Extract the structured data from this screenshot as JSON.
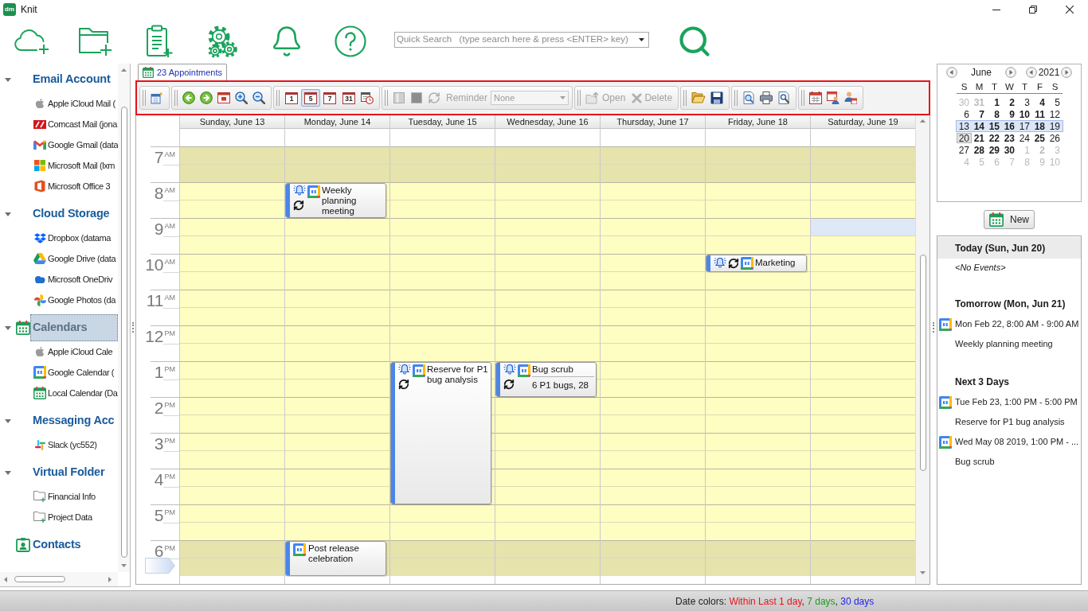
{
  "window": {
    "logo": "dm",
    "title": "Knit"
  },
  "quick_search": {
    "placeholder": "Quick Search   (type search here & press <ENTER> key)"
  },
  "sidebar": {
    "sections": [
      {
        "title": "Email Account",
        "expanded": true,
        "selected": false,
        "items": [
          {
            "label": "Apple iCloud Mail ("
          },
          {
            "label": "Comcast Mail (jona"
          },
          {
            "label": "Google Gmail (data"
          },
          {
            "label": "Microsoft Mail (lxm"
          },
          {
            "label": "Microsoft Office 3"
          }
        ]
      },
      {
        "title": "Cloud Storage",
        "expanded": true,
        "selected": false,
        "items": [
          {
            "label": "Dropbox (datama"
          },
          {
            "label": "Google Drive (data"
          },
          {
            "label": "Microsoft OneDriv"
          },
          {
            "label": "Google Photos (da"
          }
        ]
      },
      {
        "title": "Calendars",
        "expanded": true,
        "selected": true,
        "items": [
          {
            "label": "Apple iCloud Cale"
          },
          {
            "label": "Google Calendar ("
          },
          {
            "label": "Local Calendar (Da"
          }
        ]
      },
      {
        "title": "Messaging Acc",
        "expanded": true,
        "selected": false,
        "items": [
          {
            "label": "Slack (yc552)"
          }
        ]
      },
      {
        "title": "Virtual Folder",
        "expanded": true,
        "selected": false,
        "items": [
          {
            "label": "Financial Info"
          },
          {
            "label": "Project Data"
          }
        ]
      },
      {
        "title": "Contacts",
        "selected": false
      }
    ]
  },
  "tabs": [
    {
      "label": "23 Appointments",
      "selected": true
    }
  ],
  "toolbar": {
    "views": [
      {
        "label": "1",
        "selected": false
      },
      {
        "label": "5",
        "selected": true
      },
      {
        "label": "7",
        "selected": false
      },
      {
        "label": "31",
        "selected": false
      }
    ],
    "reminder": {
      "label": "Reminder",
      "value": "None",
      "disabled": true
    },
    "open": {
      "label": "Open",
      "disabled": true
    },
    "delete": {
      "label": "Delete",
      "disabled": true
    }
  },
  "calendar": {
    "columns": [
      {
        "header": "Sunday, June 13",
        "selected": false
      },
      {
        "header": "Monday, June 14",
        "selected": false,
        "events": [
          {
            "title": "Weekly planning meeting",
            "reminder": true,
            "recurring": true
          },
          {
            "title": "Post release celebration",
            "reminder": false,
            "recurring": false
          }
        ]
      },
      {
        "header": "Tuesday, June 15",
        "selected": false,
        "events": [
          {
            "title": "Reserve for P1 bug analysis",
            "reminder": true,
            "recurring": true
          }
        ]
      },
      {
        "header": "Wednesday, June 16",
        "selected": false,
        "events": [
          {
            "title": "Bug scrub",
            "detail": "6 P1 bugs, 28",
            "reminder": true,
            "recurring": true
          }
        ]
      },
      {
        "header": "Thursday, June 17",
        "selected": false
      },
      {
        "header": "Friday, June 18",
        "selected": false,
        "events": [
          {
            "title": "Marketing",
            "reminder": true,
            "recurring": true
          }
        ]
      },
      {
        "header": "Saturday, June 19",
        "selected": true
      }
    ],
    "hours": [
      {
        "hour": "7",
        "suffix": "AM",
        "off_hours": true
      },
      {
        "hour": "8",
        "suffix": "AM",
        "off_hours": false
      },
      {
        "hour": "9",
        "suffix": "AM",
        "off_hours": false
      },
      {
        "hour": "10",
        "suffix": "AM",
        "off_hours": false
      },
      {
        "hour": "11",
        "suffix": "AM",
        "off_hours": false
      },
      {
        "hour": "12",
        "suffix": "PM",
        "off_hours": false
      },
      {
        "hour": "1",
        "suffix": "PM",
        "off_hours": false
      },
      {
        "hour": "2",
        "suffix": "PM",
        "off_hours": false
      },
      {
        "hour": "3",
        "suffix": "PM",
        "off_hours": false
      },
      {
        "hour": "4",
        "suffix": "PM",
        "off_hours": false
      },
      {
        "hour": "5",
        "suffix": "PM",
        "off_hours": false
      },
      {
        "hour": "6",
        "suffix": "PM",
        "off_hours": true
      }
    ]
  },
  "mini_calendar": {
    "month": "June",
    "year": "2021",
    "weekdays": [
      "S",
      "M",
      "T",
      "W",
      "T",
      "F",
      "S"
    ],
    "weeks": [
      {
        "selected": false,
        "days": [
          {
            "day": "30",
            "other_month": true,
            "has_events": false,
            "today": false
          },
          {
            "day": "31",
            "other_month": true,
            "has_events": true,
            "today": false
          },
          {
            "day": "1",
            "other_month": false,
            "has_events": true,
            "today": false
          },
          {
            "day": "2",
            "other_month": false,
            "has_events": true,
            "today": false
          },
          {
            "day": "3",
            "other_month": false,
            "has_events": false,
            "today": false
          },
          {
            "day": "4",
            "other_month": false,
            "has_events": true,
            "today": false
          },
          {
            "day": "5",
            "other_month": false,
            "has_events": false,
            "today": false
          }
        ]
      },
      {
        "selected": false,
        "days": [
          {
            "day": "6",
            "other_month": false,
            "has_events": false,
            "today": false
          },
          {
            "day": "7",
            "other_month": false,
            "has_events": true,
            "today": false
          },
          {
            "day": "8",
            "other_month": false,
            "has_events": true,
            "today": false
          },
          {
            "day": "9",
            "other_month": false,
            "has_events": true,
            "today": false
          },
          {
            "day": "10",
            "other_month": false,
            "has_events": true,
            "today": false
          },
          {
            "day": "11",
            "other_month": false,
            "has_events": true,
            "today": false
          },
          {
            "day": "12",
            "other_month": false,
            "has_events": false,
            "today": false
          }
        ]
      },
      {
        "selected": true,
        "days": [
          {
            "day": "13",
            "other_month": false,
            "has_events": false,
            "today": false
          },
          {
            "day": "14",
            "other_month": false,
            "has_events": true,
            "today": false
          },
          {
            "day": "15",
            "other_month": false,
            "has_events": true,
            "today": false
          },
          {
            "day": "16",
            "other_month": false,
            "has_events": true,
            "today": false
          },
          {
            "day": "17",
            "other_month": false,
            "has_events": false,
            "today": false
          },
          {
            "day": "18",
            "other_month": false,
            "has_events": true,
            "today": false
          },
          {
            "day": "19",
            "other_month": false,
            "has_events": false,
            "today": false
          }
        ]
      },
      {
        "selected": false,
        "days": [
          {
            "day": "20",
            "other_month": false,
            "has_events": false,
            "today": true
          },
          {
            "day": "21",
            "other_month": false,
            "has_events": true,
            "today": false
          },
          {
            "day": "22",
            "other_month": false,
            "has_events": true,
            "today": false
          },
          {
            "day": "23",
            "other_month": false,
            "has_events": true,
            "today": false
          },
          {
            "day": "24",
            "other_month": false,
            "has_events": false,
            "today": false
          },
          {
            "day": "25",
            "other_month": false,
            "has_events": true,
            "today": false
          },
          {
            "day": "26",
            "other_month": false,
            "has_events": false,
            "today": false
          }
        ]
      },
      {
        "selected": false,
        "days": [
          {
            "day": "27",
            "other_month": false,
            "has_events": false,
            "today": false
          },
          {
            "day": "28",
            "other_month": false,
            "has_events": true,
            "today": false
          },
          {
            "day": "29",
            "other_month": false,
            "has_events": true,
            "today": false
          },
          {
            "day": "30",
            "other_month": false,
            "has_events": true,
            "today": false
          },
          {
            "day": "1",
            "other_month": true,
            "has_events": false,
            "today": false
          },
          {
            "day": "2",
            "other_month": true,
            "has_events": true,
            "today": false
          },
          {
            "day": "3",
            "other_month": true,
            "has_events": false,
            "today": false
          }
        ]
      },
      {
        "selected": false,
        "days": [
          {
            "day": "4",
            "other_month": true,
            "has_events": false,
            "today": false
          },
          {
            "day": "5",
            "other_month": true,
            "has_events": false,
            "today": false
          },
          {
            "day": "6",
            "other_month": true,
            "has_events": false,
            "today": false
          },
          {
            "day": "7",
            "other_month": true,
            "has_events": false,
            "today": false
          },
          {
            "day": "8",
            "other_month": true,
            "has_events": false,
            "today": false
          },
          {
            "day": "9",
            "other_month": true,
            "has_events": false,
            "today": false
          },
          {
            "day": "10",
            "other_month": true,
            "has_events": false,
            "today": false
          }
        ]
      }
    ]
  },
  "new_button": {
    "label": "New"
  },
  "agenda": {
    "sections": [
      {
        "title": "Today (Sun, Jun 20)",
        "selected": true,
        "empty_text": "<No Events>"
      },
      {
        "title": "Tomorrow (Mon, Jun 21)",
        "selected": false,
        "events": [
          {
            "when": "Mon Feb 22, 8:00 AM - 9:00 AM",
            "title": "Weekly planning meeting"
          }
        ]
      },
      {
        "title": "Next 3 Days",
        "selected": false,
        "events": [
          {
            "when": "Tue Feb 23, 1:00 PM - 5:00 PM",
            "title": "Reserve for P1 bug analysis"
          },
          {
            "when": "Wed May 08 2019, 1:00 PM - ...",
            "title": "Bug scrub"
          }
        ]
      }
    ]
  },
  "status_bar": {
    "label": "Date colors:",
    "legend": [
      {
        "text": "Within Last 1 day",
        "color": "#e8141c",
        "separator": ","
      },
      {
        "text": "7 days",
        "color": "#1e9a1e",
        "separator": ","
      },
      {
        "text": "30 days",
        "color": "#1c1cf0"
      }
    ]
  }
}
